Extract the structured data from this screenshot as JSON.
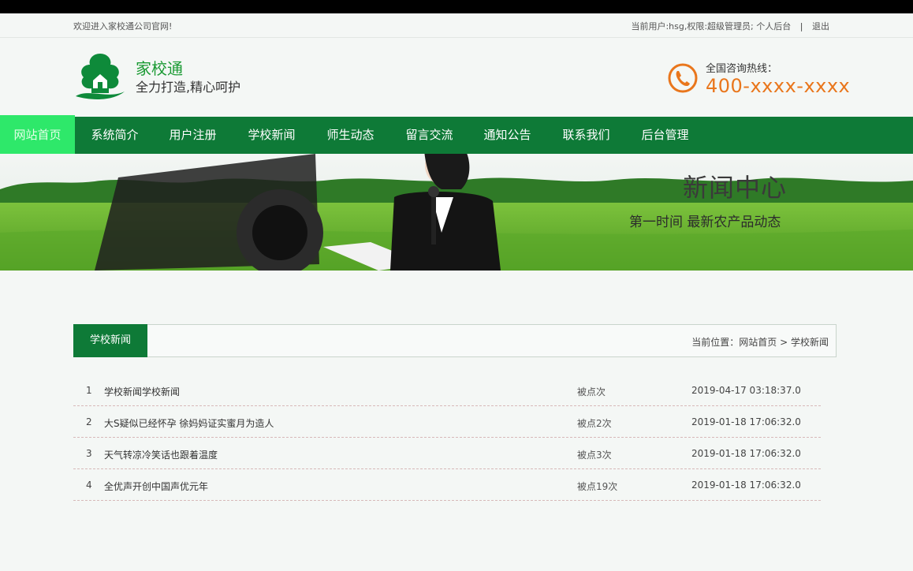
{
  "topbar": {
    "welcome": "欢迎进入家校通公司官网!",
    "user_info": "当前用户:hsg,权限:超级管理员;",
    "personal_backend": "个人后台",
    "separator": "|",
    "logout": "退出"
  },
  "header": {
    "site_name": "家校通",
    "slogan": "全力打造,精心呵护",
    "hotline_label": "全国咨询热线：",
    "hotline_number": "400-xxxx-xxxx"
  },
  "nav": {
    "items": [
      {
        "label": "网站首页"
      },
      {
        "label": "系统简介"
      },
      {
        "label": "用户注册"
      },
      {
        "label": "学校新闻"
      },
      {
        "label": "师生动态"
      },
      {
        "label": "留言交流"
      },
      {
        "label": "通知公告"
      },
      {
        "label": "联系我们"
      },
      {
        "label": "后台管理"
      }
    ]
  },
  "banner": {
    "title": "新闻中心",
    "subtitle": "第一时间  最新农产品动态"
  },
  "section": {
    "tab_label": "学校新闻",
    "breadcrumb_prefix": "当前位置：",
    "breadcrumb_home": "网站首页",
    "breadcrumb_sep": ">",
    "breadcrumb_current": "学校新闻"
  },
  "news": [
    {
      "index": "1",
      "title": "学校新闻学校新闻",
      "clicks": "被点次",
      "date": "2019-04-17 03:18:37.0"
    },
    {
      "index": "2",
      "title": "大S疑似已经怀孕 徐妈妈证实蜜月为造人",
      "clicks": "被点2次",
      "date": "2019-01-18 17:06:32.0"
    },
    {
      "index": "3",
      "title": "天气转凉冷笑话也跟着温度",
      "clicks": "被点3次",
      "date": "2019-01-18 17:06:32.0"
    },
    {
      "index": "4",
      "title": "全优声开创中国声优元年",
      "clicks": "被点19次",
      "date": "2019-01-18 17:06:32.0"
    }
  ],
  "colors": {
    "nav_green": "#0e7a37",
    "active_green": "#2ee86a",
    "brand_green": "#1a9a33",
    "hotline_orange": "#e9761c"
  },
  "icons": {
    "logo": "house-tree-logo-icon",
    "hotline": "phone-icon"
  }
}
